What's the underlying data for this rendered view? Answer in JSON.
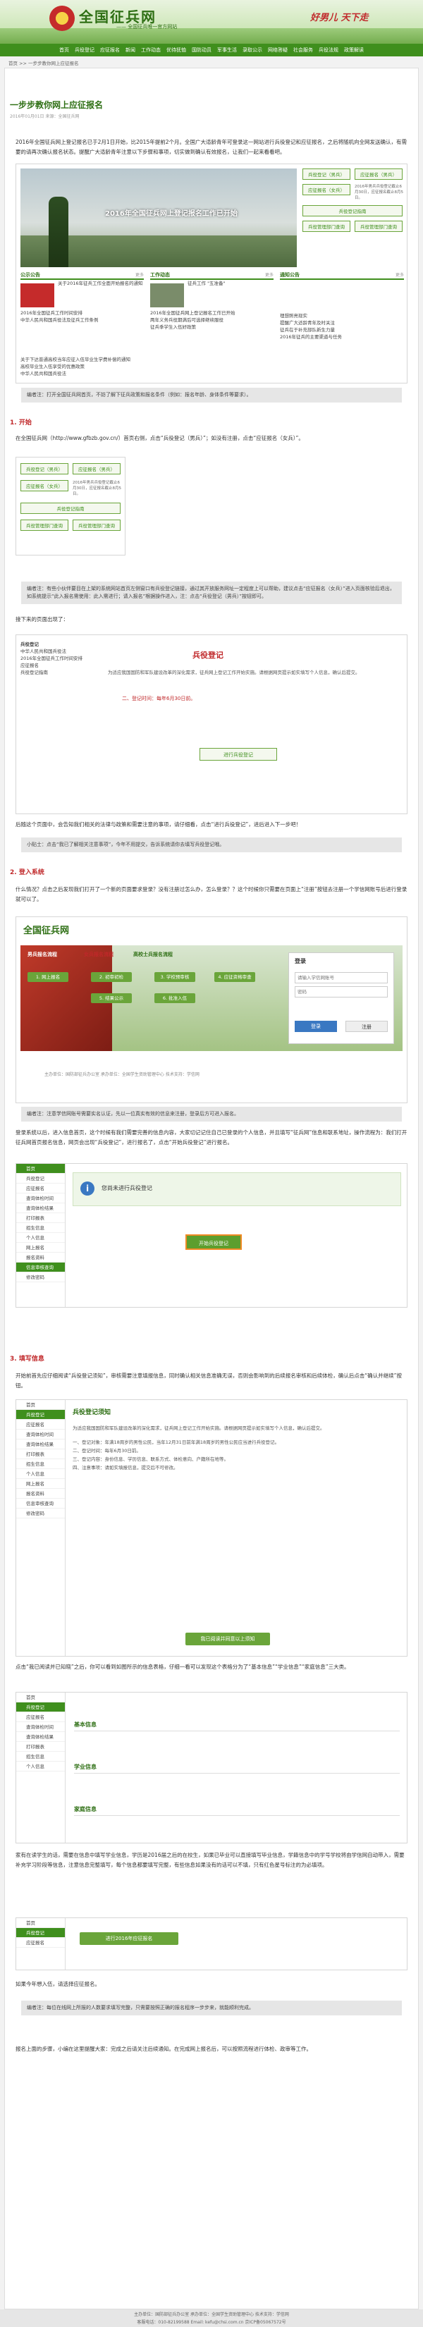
{
  "site": {
    "logo": "全国征兵网",
    "slogan": "—— 全国征兵唯一官方网站",
    "banner_tagline": "好男儿 天下走"
  },
  "nav": [
    "首页",
    "兵役登记",
    "应征报名",
    "新闻",
    "工作动态",
    "优待抚恤",
    "国防动员",
    "军事生活",
    "录取公示",
    "网络答疑",
    "社会服务",
    "兵役法规",
    "政策解读"
  ],
  "breadcrumb": "首页 >> 一步步教你网上应征报名",
  "article": {
    "title": "一步步教你网上应征报名",
    "meta": "2016年01月01日    来源：全国征兵网",
    "intro": "2016年全国征兵网上登记报名已于2月1日开始，比2015年提前2个月。全国广大适龄青年可登录这一网站进行兵役登记和应征报名，之后将随机向全网发送确认，有需要的请再次确认报名状态。提醒广大适龄青年注意以下步骤和事项，切实做到确认有效报名，让我们一起来看看吧。",
    "banner_text": "2016年全国征兵网上登记报名工作已开始",
    "side_buttons": [
      "兵役登记（男兵）",
      "应征报名（男兵）",
      "应征报名（女兵）",
      "兵役登记指南",
      "兵役管理部门查询",
      "兵役管理部门查询"
    ],
    "side_notice": "2016年男兵兵役登记截止6月30日，应征报名截止8月5日。",
    "cols": [
      {
        "title": "公示公告",
        "more": "更多",
        "items": [
          "关于2016年征兵工作全面开始报名的通知",
          "2016年全国征兵工作时间安排",
          "中华人民共和国兵役法及征兵工作条例"
        ]
      },
      {
        "title": "工作动态",
        "more": "更多",
        "items": [
          "征兵工作 \"五准备\"",
          "2016年全国征兵网上登记报名工作已开始",
          "两年义务兵役期满后可选择继续服役",
          "征兵季学生入伍好政策"
        ]
      },
      {
        "title": "通知公告",
        "more": "更多",
        "items": [
          "理想照亮现实",
          "提醒广大适龄青年及时关注",
          "征兵在于补充部队新生力量",
          "2016年征兵的主要渠道与任务"
        ]
      }
    ],
    "bottom_links": [
      "关于下达普通高校当年应征入伍毕业生学费补偿的通知",
      "高校毕业生入伍享受的优惠政策",
      "中华人民共和国兵役法"
    ],
    "note1": "编者注：打开全国征兵网首页，不妨了解下征兵政策和报名条件（例如：报名年龄、身体条件等要求）。",
    "sec1": "1. 开始",
    "p1": "在全国征兵网（http://www.gfbzb.gov.cn/）首页右侧，点击“兵役登记（男兵）”；如没有注册，点击“应征报名（女兵）”。",
    "note2": "编者注：有些小伙伴要目在上架的系统网站首页左侧窗口有兵役登记链接，通过其开放服务网址一定程度上可以帮助，建议点击“应征报名（女兵）”进入页面核验后退出，如系统提示“此入报名需使用：此入需进行；请入报名”根据操作进入，注：点击“兵役登记（男兵）”按钮即可。",
    "p2": "接下来的页面出现了：",
    "big_btn": "兵役登记",
    "big_btn2": "进行兵役登记",
    "p3": "后随这个页面中，会告知我们相关的法律与政策和需要注意的事项，请仔细看，点击“进行兵役登记”，进后进入下一步吧！",
    "note3": "小贴士：点击“我已了解相关注意事项”，今年不用提交，告诉系统请你去填写兵役登记哦。",
    "sec2": "2. 登入系统",
    "p4": "什么情况？点击之后发现我们打开了一个新的页面要求登录？没有注册过怎么办，怎么登录？？这个时候你只需要在页面上“注册”按钮去注册一个学信网账号后进行登录就可以了。",
    "login_title": "登录",
    "login_user_ph": "请输入学信网账号",
    "login_pass_ph": "密码",
    "login_btn": "登录",
    "register_btn": "注册",
    "flow_steps": [
      "1. 网上报名",
      "2. 初审初检",
      "3. 学校预审核",
      "4. 应征资格审查",
      "5. 结果公示",
      "6. 批准入伍"
    ],
    "flow_tabs": [
      "男兵报名流程",
      "女兵报名流程",
      "高校士兵报名流程"
    ],
    "note4": "编者注：注意学信网账号需要实名认证，先以一位真实有效的信息来注册，登录后方可进入报名。",
    "p5": "登录系统以后，进入信息首页，这个时候有我们需要完善的信息内容，大家切记记住自己已登录的个人信息，并且填写“征兵网”信息和联系地址，操作流程为：我们打开征兵网首页报名信息，网页会出现“兵役登记”，进行报名了，点击“开始兵役登记”进行报名。",
    "welcome_title": "您尚未进行兵役登记",
    "start_btn": "开始兵役登记",
    "side_menu": [
      "首页",
      "兵役登记",
      "应征报名",
      "查询体检时间",
      "查询体检结果",
      "打印报表",
      "招生信息",
      "个人信息",
      "网上报名",
      "报名资料",
      "信息审核查询",
      "修改密码"
    ],
    "sec3": "3. 填写信息",
    "p6": "开始前首先应仔细阅读“兵役登记须知”，审核需要注意填报信息，同时确认相关信息准确无误，否则会影响到的后续报名审核和后续体检，确认后点击“确认并继续”按钮。",
    "form_title": "兵役登记须知",
    "form_lines": [
      "为适应我国国防和军队建设改革的深化需求，征兵网上登记工作开始实施。请根据网页提示如实填写个人信息，确认后提交。",
      "一、登记对象：年满18周岁的男性公民，当年12月31日前年满18周岁的男性公民应当进行兵役登记。",
      "二、登记时间：每年6月30日前。",
      "三、登记内容：身份信息、学历信息、联系方式、体检意向、户籍所在地等。",
      "四、注意事项：请如实填报信息，提交后不可修改。"
    ],
    "form_btn": "我已阅读并同意以上须知",
    "p7": "点击“我已阅读并已知晓”之后，你可以看到如图所示的信息表格，仔细一看可以发现这个表格分为了“基本信息”“学业信息”“家庭信息”三大类。",
    "info_sections": [
      "基本信息",
      "学业信息",
      "家庭信息"
    ],
    "p8": "家有在读学生的话，需要在信息中填写学业信息，学历是2016届之后的在校生，如果已毕业可以直接填写毕业信息，学籍信息中的学号学校将由学信网自动带入，需要补充学习阶段等信息，注意信息完整填写，每个信息都要填写完整，有些信息如果没有的话可以不填，只有红色星号标注的为必填项。",
    "final_btn": "进行2016年应征报名",
    "p9": "如果今年想入伍，请选择应征报名。",
    "note5": "编者注：每位在线网上所报的人数要求填写完整，只需要按照正确的报名程序一步步来，就能顺利完成。",
    "p10": "报名上面的步骤，小编在这里提醒大家：完成之后请关注后续通知。在完成网上报名后，可以按照流程进行体检、政审等工作。",
    "footer1": "主办单位：国防部征兵办公室  承办单位：全国学生资助管理中心  技术支持：学信网",
    "footer2": "客服电话：010-82199588  Email: kefu@chsi.com.cn  京ICP备05067572号"
  }
}
